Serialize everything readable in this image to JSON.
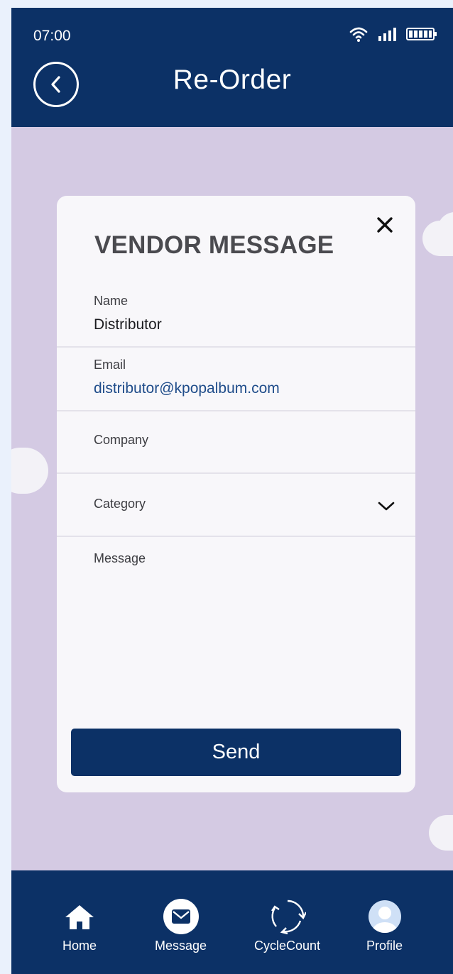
{
  "status_bar": {
    "time": "07:00"
  },
  "header": {
    "title": "Re-Order"
  },
  "card": {
    "title": "VENDOR MESSAGE",
    "fields": [
      {
        "label": "Name",
        "value": "Distributor"
      },
      {
        "label": "Email",
        "value": "distributor@kpopalbum.com"
      },
      {
        "label": "Company",
        "value": ""
      },
      {
        "label": "Category",
        "value": ""
      },
      {
        "label": "Message",
        "value": ""
      }
    ],
    "send_label": "Send"
  },
  "nav": {
    "items": [
      {
        "label": "Home",
        "icon": "home-icon"
      },
      {
        "label": "Message",
        "icon": "envelope-icon"
      },
      {
        "label": "CycleCount",
        "icon": "cycle-icon"
      },
      {
        "label": "Profile",
        "icon": "avatar-icon"
      }
    ]
  },
  "colors": {
    "primary": "#0c3166",
    "background": "#d4cae3",
    "card": "#f8f7fa",
    "email_link": "#1f4c8a"
  }
}
